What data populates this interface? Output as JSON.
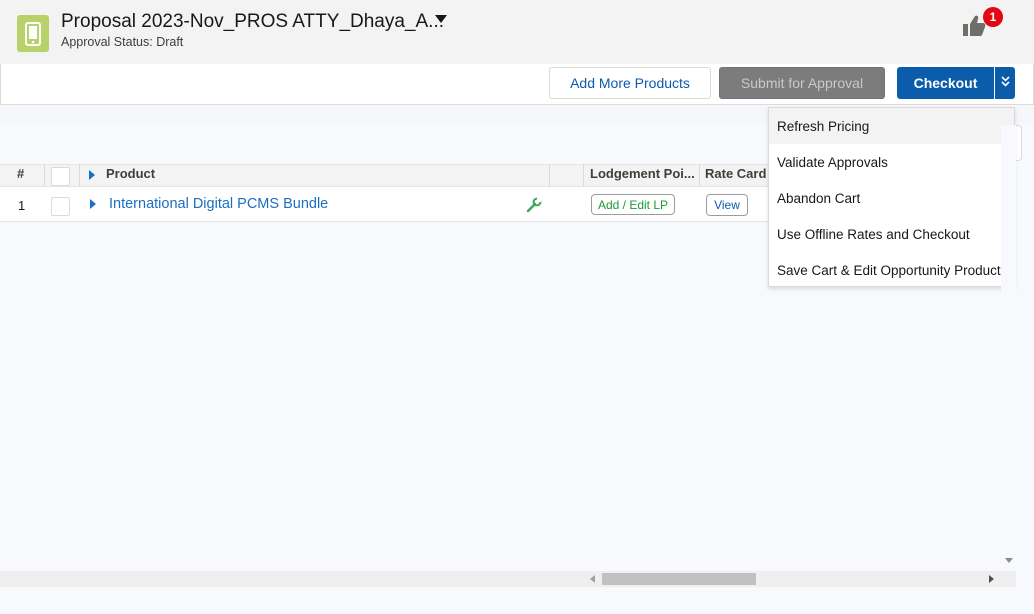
{
  "header": {
    "title": "Proposal 2023-Nov_PROS ATTY_Dhaya_A...",
    "status": "Approval Status: Draft",
    "notification_count": "1",
    "app_icon": "mobile-device-icon",
    "notification_icon": "thumbs-up-icon"
  },
  "toolbar": {
    "add_more_products": "Add More Products",
    "submit_for_approval": "Submit for Approval",
    "checkout": "Checkout",
    "more_icon": "double-chevron-down-icon"
  },
  "menu": {
    "items": [
      "Refresh Pricing",
      "Validate Approvals",
      "Abandon Cart",
      "Use Offline Rates and Checkout",
      "Save Cart & Edit Opportunity Products"
    ]
  },
  "table": {
    "headers": {
      "num": "#",
      "product": "Product",
      "lodgement": "Lodgement Poi...",
      "rate_card": "Rate Card"
    },
    "rows": [
      {
        "num": "1",
        "product": "International Digital PCMS Bundle",
        "lp_button": "Add / Edit LP",
        "view_button": "View"
      }
    ]
  },
  "colors": {
    "brand_blue": "#0b5cab",
    "link_blue": "#1b6fc1",
    "badge_red": "#e30613",
    "app_icon_green": "#b8d16a",
    "lp_green": "#1a9c32"
  }
}
